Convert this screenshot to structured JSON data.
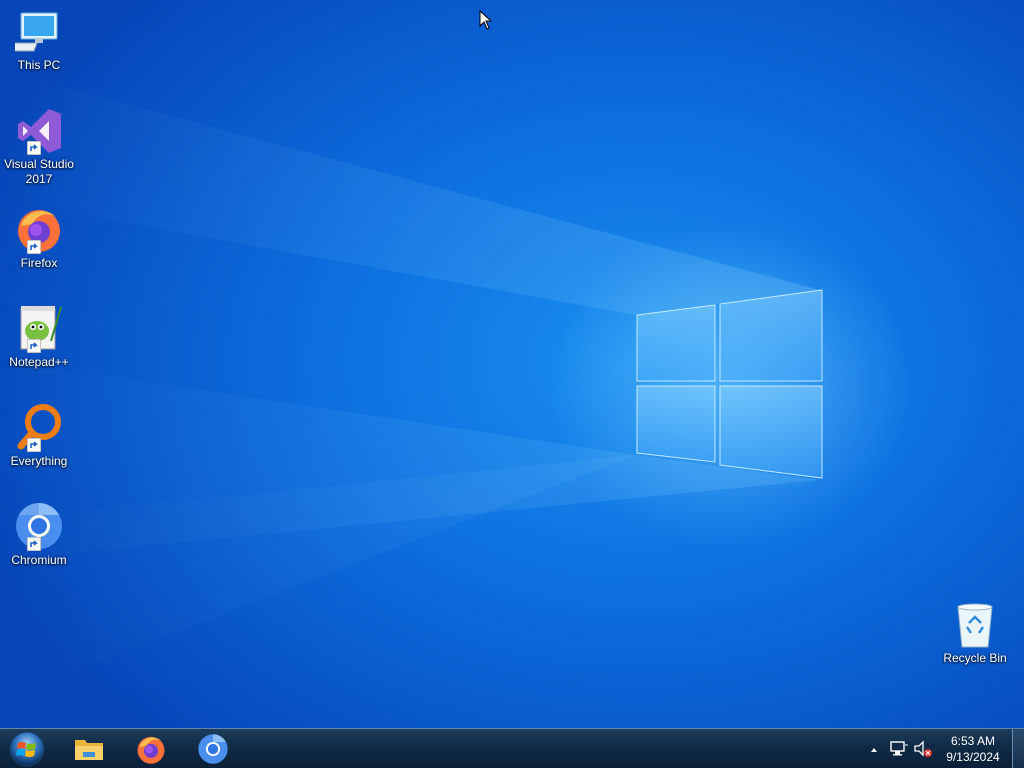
{
  "desktop": {
    "icons": [
      {
        "label_line1": "This PC",
        "label_line2": "",
        "icon": "this-pc-icon"
      },
      {
        "label_line1": "Visual Studio",
        "label_line2": "2017",
        "icon": "visual-studio-icon"
      },
      {
        "label_line1": "Firefox",
        "label_line2": "",
        "icon": "firefox-icon"
      },
      {
        "label_line1": "Notepad++",
        "label_line2": "",
        "icon": "notepad-plus-plus-icon"
      },
      {
        "label_line1": "Everything",
        "label_line2": "",
        "icon": "everything-search-icon"
      },
      {
        "label_line1": "Chromium",
        "label_line2": "",
        "icon": "chromium-icon"
      },
      {
        "label_line1": "Recycle Bin",
        "label_line2": "",
        "icon": "recycle-bin-icon"
      }
    ]
  },
  "taskbar": {
    "start": {
      "icon": "windows-start-orb-icon"
    },
    "pinned": [
      {
        "icon": "file-explorer-icon"
      },
      {
        "icon": "firefox-icon"
      },
      {
        "icon": "chromium-icon"
      }
    ],
    "tray": {
      "arrow_icon": "show-hidden-icons-arrow-icon",
      "network_icon": "network-icon",
      "volume_icon": "volume-muted-icon"
    },
    "clock": {
      "time": "6:53 AM",
      "date": "9/13/2024"
    }
  },
  "colors": {
    "desktop_bg": "#0d6fe0",
    "taskbar_bg": "#102a45",
    "accent": "#2a9bf0"
  }
}
